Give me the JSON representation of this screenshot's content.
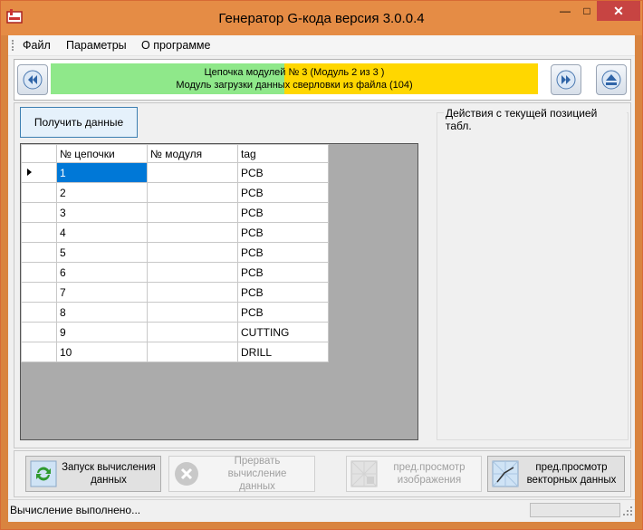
{
  "window": {
    "title": "Генератор G-кода версия 3.0.0.4"
  },
  "menu": {
    "items": [
      "Файл",
      "Параметры",
      "О программе"
    ]
  },
  "chain": {
    "line1": "Цепочка модулей № 3 (Модуль 2 из 3 )",
    "line2": "Модуль загрузки данных сверловки из файла (104)"
  },
  "main": {
    "get_data_label": "Получить данные",
    "group_title": "Действия с текущей позицией табл."
  },
  "table": {
    "headers": [
      "№ цепочки",
      "№ модуля",
      "tag"
    ],
    "rows": [
      [
        "1",
        "",
        "PCB"
      ],
      [
        "2",
        "",
        "PCB"
      ],
      [
        "3",
        "",
        "PCB"
      ],
      [
        "4",
        "",
        "PCB"
      ],
      [
        "5",
        "",
        "PCB"
      ],
      [
        "6",
        "",
        "PCB"
      ],
      [
        "7",
        "",
        "PCB"
      ],
      [
        "8",
        "",
        "PCB"
      ],
      [
        "9",
        "",
        "CUTTING"
      ],
      [
        "10",
        "",
        "DRILL"
      ]
    ]
  },
  "actions": {
    "start_line1": "Запуск вычисления",
    "start_line2": "данных",
    "abort_line1": "Прервать вычисление",
    "abort_line2": "данных",
    "preview_img_line1": "пред.просмотр",
    "preview_img_line2": "изображения",
    "preview_vec_line1": "пред.просмотр",
    "preview_vec_line2": "векторных данных"
  },
  "status": {
    "text": "Вычисление выполнено..."
  },
  "colors": {
    "green_band": "#8fe88a",
    "yellow_band": "#ffd700",
    "title_bar": "#e58c45",
    "close": "#c74442",
    "selection": "#0078d7"
  }
}
